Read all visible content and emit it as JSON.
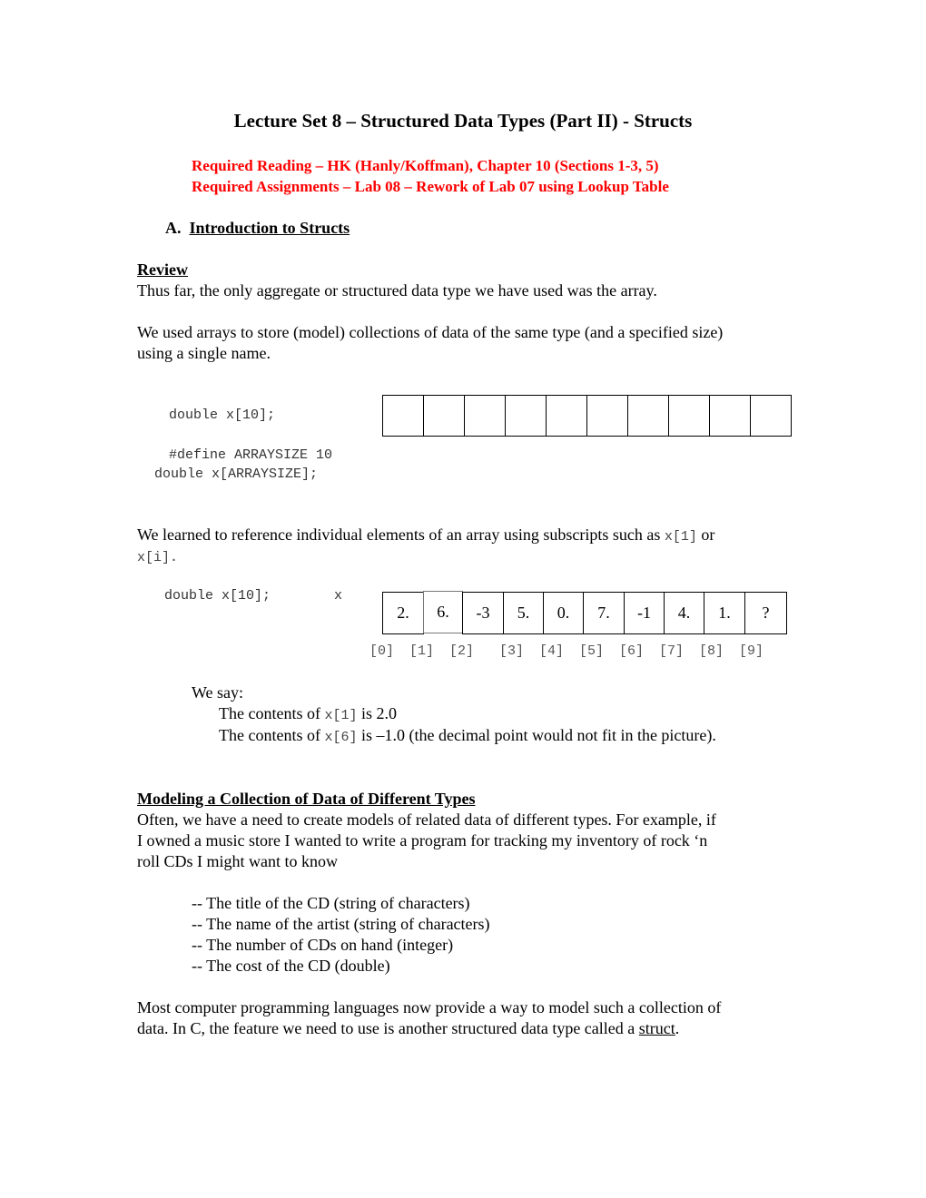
{
  "title": "Lecture Set 8 – Structured Data Types (Part II) - Structs",
  "required": {
    "reading": "Required Reading – HK (Hanly/Koffman), Chapter 10 (Sections 1-3, 5)",
    "assignments": "Required Assignments – Lab 08 – Rework of Lab 07 using Lookup Table"
  },
  "section_a": {
    "number": "A.",
    "heading": "Introduction to Structs"
  },
  "review": {
    "heading": "Review",
    "p1": "Thus far, the only aggregate or structured data type we have used was the array.",
    "p2_line1": "We used arrays to store (model) collections of data of the same type (and a specified size)",
    "p2_line2": "using a single name."
  },
  "code1": {
    "decl": "double x[10];",
    "define": "#define ARRAYSIZE 10",
    "decl2": "double x[ARRAYSIZE];"
  },
  "empty_array_cells": 10,
  "subscripts": {
    "line1_text": "We learned to reference individual elements of an array using subscripts such as ",
    "code_a": "x[1]",
    "or": " or",
    "code_b": "x[i]",
    "period": "."
  },
  "array_example": {
    "decl": "double x[10];",
    "var": "x",
    "values": [
      "2.",
      "6.",
      "-3",
      "5.",
      "0.",
      "7.",
      "-1",
      "4.",
      "1.",
      "?"
    ],
    "indices": [
      "[0]",
      "[1]",
      "[2]",
      "[3]",
      "[4]",
      "[5]",
      "[6]",
      "[7]",
      "[8]",
      "[9]"
    ]
  },
  "we_say": {
    "label": "We say:",
    "line1_pre": "The contents of ",
    "line1_code": "x[1]",
    "line1_post": " is 2.0",
    "line2_pre": "The contents of ",
    "line2_code": "x[6]",
    "line2_post": " is –1.0 (the decimal point would not fit in the picture)."
  },
  "modeling": {
    "heading": "Modeling a Collection of Data of Different Types",
    "lines": [
      "Often, we have a need to create models of related data of different types.  For example, if",
      "I owned a music store I wanted to write a program for tracking my inventory of rock ‘n",
      "roll CDs I might want to know"
    ],
    "items": [
      "-- The title of the CD (string of characters)",
      "-- The name of the artist (string of characters)",
      "-- The number of CDs on hand (integer)",
      "-- The cost of the CD (double)"
    ],
    "closing_line1": "Most computer programming languages now provide a way to model such a collection of",
    "closing_line2_pre": "data.  In C, the feature we need to use is another structured data type called a ",
    "closing_term": "struct",
    "closing_period": "."
  }
}
